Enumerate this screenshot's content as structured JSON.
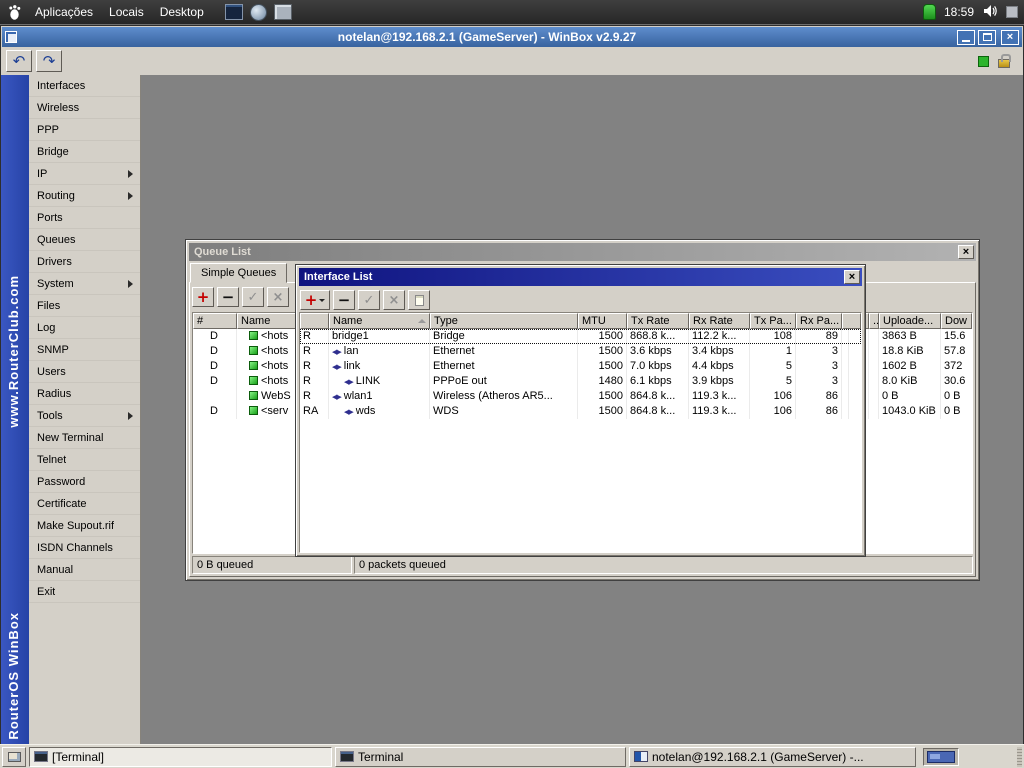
{
  "top_panel": {
    "menus": [
      {
        "label": "Aplicações"
      },
      {
        "label": "Locais"
      },
      {
        "label": "Desktop"
      }
    ],
    "launchers": [
      "terminal-launcher-icon",
      "web-launcher-icon",
      "screenshot-launcher-icon"
    ],
    "tray": {
      "status_icon": "network-status-icon",
      "clock": "18:59",
      "volume_icon": "volume-icon",
      "tray_item_icon": "tray-item-icon"
    }
  },
  "winbox": {
    "window_title": "notelan@192.168.2.1 (GameServer) - WinBox v2.9.27",
    "toolbar_icons": [
      "undo-arrow-icon",
      "redo-arrow-icon",
      "session-status-icon",
      "secure-lock-icon"
    ],
    "brand_strip": {
      "top_text": "www.RouterClub.com",
      "bottom_text": "RouterOS WinBox"
    },
    "menu": [
      {
        "label": "Interfaces"
      },
      {
        "label": "Wireless"
      },
      {
        "label": "PPP"
      },
      {
        "label": "Bridge"
      },
      {
        "label": "IP",
        "submenu": true
      },
      {
        "label": "Routing",
        "submenu": true
      },
      {
        "label": "Ports"
      },
      {
        "label": "Queues"
      },
      {
        "label": "Drivers"
      },
      {
        "label": "System",
        "submenu": true
      },
      {
        "label": "Files"
      },
      {
        "label": "Log"
      },
      {
        "label": "SNMP"
      },
      {
        "label": "Users"
      },
      {
        "label": "Radius"
      },
      {
        "label": "Tools",
        "submenu": true
      },
      {
        "label": "New Terminal"
      },
      {
        "label": "Telnet"
      },
      {
        "label": "Password"
      },
      {
        "label": "Certificate"
      },
      {
        "label": "Make Supout.rif"
      },
      {
        "label": "ISDN Channels"
      },
      {
        "label": "Manual"
      },
      {
        "label": "Exit"
      }
    ]
  },
  "queue_list": {
    "title": "Queue List",
    "tabs": [
      "Simple Queues"
    ],
    "toolbar_icons": [
      "add-icon",
      "remove-icon",
      "enable-icon",
      "disable-icon"
    ],
    "columns": {
      "flags": "#",
      "name": "Name",
      "gap": "..",
      "upload": "Uploade...",
      "download": "Dow"
    },
    "rows": [
      {
        "flags": "D",
        "name": "<hots",
        "upload": "3863 B",
        "download": "15.6"
      },
      {
        "flags": "D",
        "name": "<hots",
        "upload": "18.8 KiB",
        "download": "57.8"
      },
      {
        "flags": "D",
        "name": "<hots",
        "upload": "1602 B",
        "download": "372"
      },
      {
        "flags": "D",
        "name": "<hots",
        "upload": "8.0 KiB",
        "download": "30.6"
      },
      {
        "flags": "",
        "name": "WebS",
        "upload": "0 B",
        "download": "0 B"
      },
      {
        "flags": "D",
        "name": "<serv",
        "upload": "1043.0 KiB",
        "download": "0 B"
      }
    ],
    "status_bar": {
      "left": "0 B queued",
      "right": "0 packets queued"
    }
  },
  "interface_list": {
    "title": "Interface List",
    "toolbar_icons": [
      "add-dropdown-icon",
      "remove-icon",
      "enable-icon",
      "disable-icon",
      "comment-icon"
    ],
    "columns": [
      "Name",
      "Type",
      "MTU",
      "Tx Rate",
      "Rx Rate",
      "Tx Pa...",
      "Rx Pa..."
    ],
    "rows": [
      {
        "flags": "R",
        "name": "bridge1",
        "type": "Bridge",
        "mtu": "1500",
        "tx_rate": "868.8 k...",
        "rx_rate": "112.2 k...",
        "tx_packets": "108",
        "rx_packets": "89",
        "indent": 0,
        "icon": false,
        "focused": true
      },
      {
        "flags": "R",
        "name": "lan",
        "type": "Ethernet",
        "mtu": "1500",
        "tx_rate": "3.6 kbps",
        "rx_rate": "3.4 kbps",
        "tx_packets": "1",
        "rx_packets": "3",
        "indent": 0,
        "icon": true
      },
      {
        "flags": "R",
        "name": "link",
        "type": "Ethernet",
        "mtu": "1500",
        "tx_rate": "7.0 kbps",
        "rx_rate": "4.4 kbps",
        "tx_packets": "5",
        "rx_packets": "3",
        "indent": 0,
        "icon": true
      },
      {
        "flags": "R",
        "name": "LINK",
        "type": "PPPoE out",
        "mtu": "1480",
        "tx_rate": "6.1 kbps",
        "rx_rate": "3.9 kbps",
        "tx_packets": "5",
        "rx_packets": "3",
        "indent": 1,
        "icon": true
      },
      {
        "flags": "R",
        "name": "wlan1",
        "type": "Wireless (Atheros AR5...",
        "mtu": "1500",
        "tx_rate": "864.8 k...",
        "rx_rate": "119.3 k...",
        "tx_packets": "106",
        "rx_packets": "86",
        "indent": 0,
        "icon": true
      },
      {
        "flags": "RA",
        "name": "wds",
        "type": "WDS",
        "mtu": "1500",
        "tx_rate": "864.8 k...",
        "rx_rate": "119.3 k...",
        "tx_packets": "106",
        "rx_packets": "86",
        "indent": 1,
        "icon": true
      }
    ]
  },
  "taskbar": {
    "buttons": [
      {
        "label": "[Terminal]",
        "icon": "terminal-icon",
        "pressed": true
      },
      {
        "label": "Terminal",
        "icon": "terminal-icon",
        "pressed": false
      },
      {
        "label": "notelan@192.168.2.1 (GameServer) -...",
        "icon": "winbox-icon",
        "pressed": false
      }
    ]
  }
}
